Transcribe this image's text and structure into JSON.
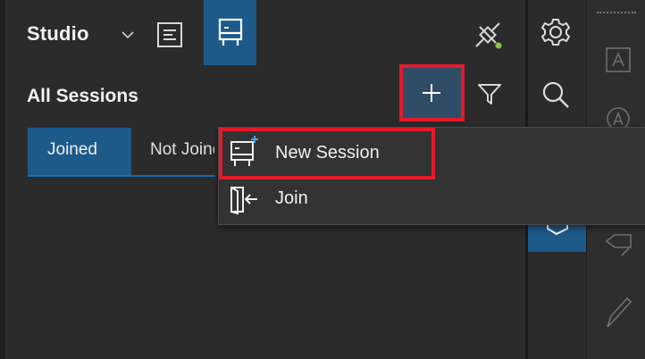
{
  "header": {
    "workspace_label": "Studio",
    "chevron_icon": "chevron-down-icon",
    "notes_icon": "notes-icon",
    "sessions_icon": "session-board-icon",
    "connection_icon": "plug-status-icon"
  },
  "sessions": {
    "title": "All Sessions",
    "add_icon": "plus-icon",
    "filter_icon": "filter-icon",
    "tabs": [
      {
        "label": "Joined",
        "active": true
      },
      {
        "label": "Not Joined",
        "active": false
      }
    ]
  },
  "menu": {
    "items": [
      {
        "label": "New Session",
        "icon": "new-session-icon"
      },
      {
        "label": "Join",
        "icon": "join-door-icon"
      }
    ]
  },
  "toolbar": {
    "icons": [
      "gear-icon",
      "search-icon"
    ]
  },
  "colors": {
    "accent": "#1d5a8a",
    "highlight_box": "#e21a2a",
    "status_dot": "#8bc34a"
  }
}
